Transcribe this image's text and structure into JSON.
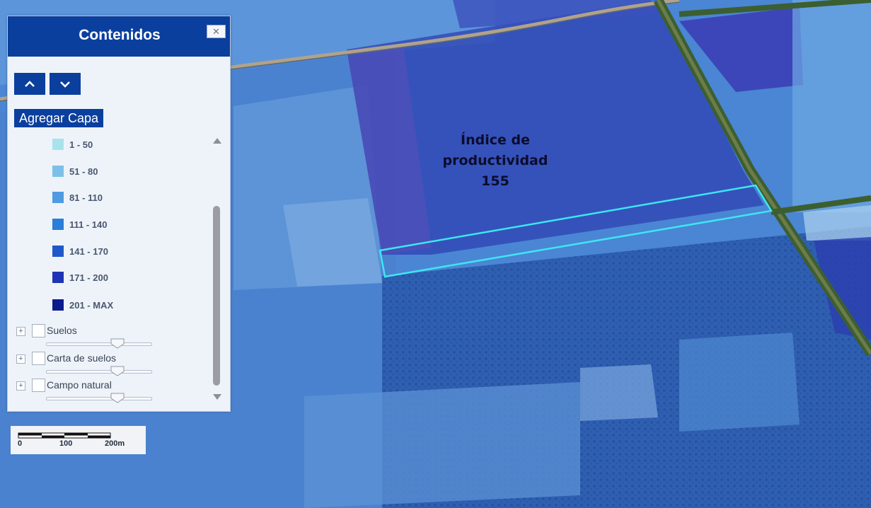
{
  "map": {
    "label_line1": "Índice de",
    "label_line2": "productividad",
    "label_value": "155",
    "highlight_color": "#3ee6f0"
  },
  "panel": {
    "title": "Contenidos",
    "close_symbol": "✕",
    "move_up_icon": "chevron-up-icon",
    "move_down_icon": "chevron-down-icon",
    "add_layer_label": "Agregar Capa",
    "legend": [
      {
        "label": "1 - 50",
        "color": "#a9e3ea"
      },
      {
        "label": "51 - 80",
        "color": "#7cc0ea"
      },
      {
        "label": "81 - 110",
        "color": "#4f9ae0"
      },
      {
        "label": "111 - 140",
        "color": "#2a7ed8"
      },
      {
        "label": "141 - 170",
        "color": "#1f58c8"
      },
      {
        "label": "171 - 200",
        "color": "#1e34b4"
      },
      {
        "label": "201 - MAX",
        "color": "#0a1b8e"
      }
    ],
    "layers": [
      {
        "name": "Suelos",
        "expand": "+"
      },
      {
        "name": "Carta de suelos",
        "expand": "+"
      },
      {
        "name": "Campo natural",
        "expand": "+"
      }
    ]
  },
  "scalebar": {
    "labels": [
      "0",
      "100",
      "200m"
    ]
  }
}
